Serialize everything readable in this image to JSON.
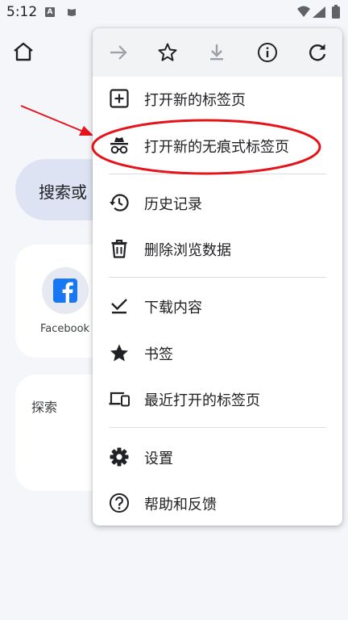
{
  "status_bar": {
    "time": "5:12",
    "app_badge": "A"
  },
  "background": {
    "search_placeholder": "搜索或",
    "tiles": [
      {
        "label": "Facebook",
        "icon": "facebook-icon"
      }
    ],
    "explore_label": "探索"
  },
  "menu": {
    "toolbar": [
      {
        "name": "forward",
        "icon": "arrow-right-icon",
        "enabled": false
      },
      {
        "name": "bookmark",
        "icon": "star-outline-icon",
        "enabled": true
      },
      {
        "name": "download",
        "icon": "download-icon",
        "enabled": false
      },
      {
        "name": "info",
        "icon": "info-icon",
        "enabled": true
      },
      {
        "name": "refresh",
        "icon": "refresh-icon",
        "enabled": true
      }
    ],
    "items": [
      {
        "label": "打开新的标签页",
        "icon": "new-tab-icon"
      },
      {
        "label": "打开新的无痕式标签页",
        "icon": "incognito-icon"
      },
      {
        "label": "历史记录",
        "icon": "history-icon"
      },
      {
        "label": "删除浏览数据",
        "icon": "trash-icon"
      },
      {
        "label": "下载内容",
        "icon": "downloads-icon"
      },
      {
        "label": "书签",
        "icon": "star-filled-icon"
      },
      {
        "label": "最近打开的标签页",
        "icon": "devices-icon"
      },
      {
        "label": "设置",
        "icon": "settings-icon"
      },
      {
        "label": "帮助和反馈",
        "icon": "help-icon"
      }
    ]
  },
  "colors": {
    "annotation": "#e5141a",
    "menu_bg": "#ffffff",
    "toolbar_bg": "#f1f3f4",
    "search_pill": "#dde3f3",
    "facebook": "#1877f2"
  }
}
